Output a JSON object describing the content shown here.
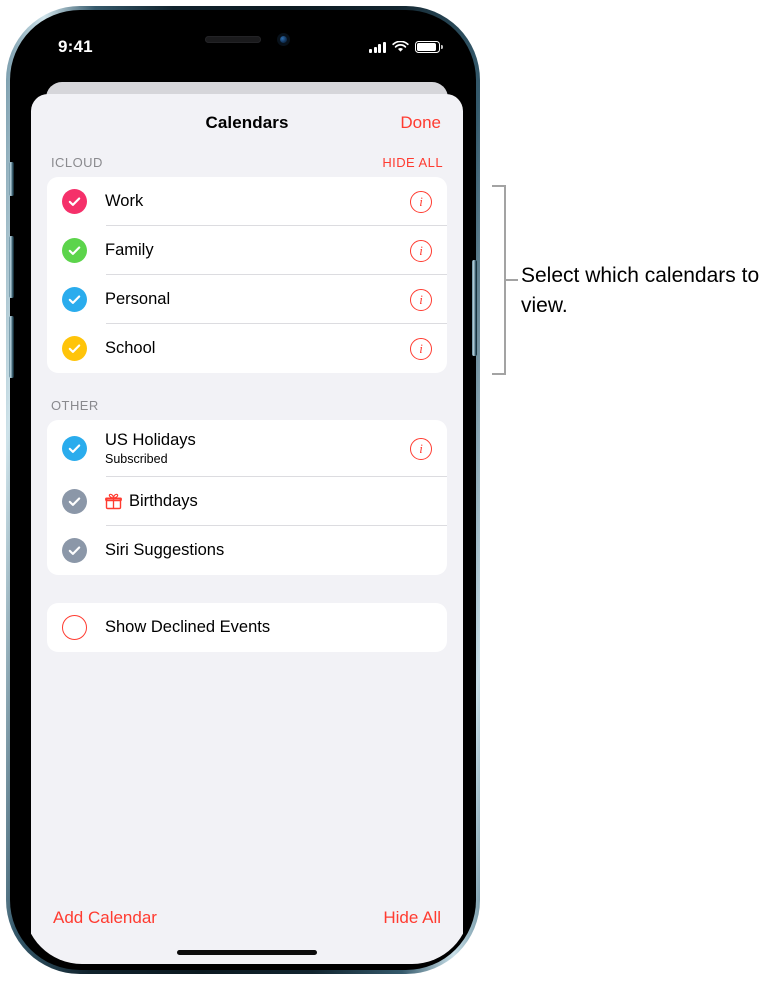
{
  "status_bar": {
    "time": "9:41",
    "icons": [
      "cellular-icon",
      "wifi-icon",
      "battery-icon"
    ]
  },
  "nav": {
    "title": "Calendars",
    "done_label": "Done"
  },
  "sections": [
    {
      "header": "ICLOUD",
      "action": "HIDE ALL",
      "rows": [
        {
          "label": "Work",
          "color": "#f5306a",
          "checked": true,
          "info": true
        },
        {
          "label": "Family",
          "color": "#5cd44b",
          "checked": true,
          "info": true
        },
        {
          "label": "Personal",
          "color": "#2aaced",
          "checked": true,
          "info": true
        },
        {
          "label": "School",
          "color": "#ffc40a",
          "checked": true,
          "info": true
        }
      ]
    },
    {
      "header": "OTHER",
      "action": "",
      "rows": [
        {
          "label": "US Holidays",
          "sublabel": "Subscribed",
          "color": "#2aaced",
          "checked": true,
          "info": true
        },
        {
          "label": "Birthdays",
          "color": "#8b97a8",
          "checked": true,
          "info": false,
          "icon": "gift-icon"
        },
        {
          "label": "Siri Suggestions",
          "color": "#8b97a8",
          "checked": true,
          "info": false
        }
      ]
    }
  ],
  "declined": {
    "label": "Show Declined Events",
    "checked": false,
    "ring_color": "#ff3b30"
  },
  "toolbar": {
    "add_calendar_label": "Add Calendar",
    "hide_all_label": "Hide All"
  },
  "callout": {
    "text": "Select which calendars to view."
  },
  "colors": {
    "accent_red": "#ff3b30",
    "sheet_background": "#f2f2f6",
    "card_background": "#ffffff",
    "separator": "#dcdce0",
    "secondary_text": "#8a8a8e",
    "callout_gray": "#a3a3a3"
  }
}
